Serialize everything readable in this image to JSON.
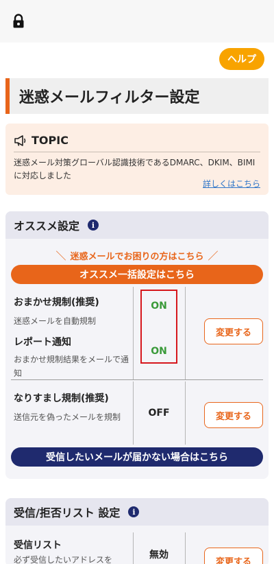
{
  "header": {
    "help_label": "ヘルプ"
  },
  "page": {
    "title": "迷惑メールフィルター設定"
  },
  "topic": {
    "title": "TOPIC",
    "text": "迷惑メール対策グローバル認識技術であるDMARC、DKIM、BIMIに対応しました",
    "link": "詳しくはこちら"
  },
  "recommended": {
    "title": "オススメ設定",
    "info_icon": "i",
    "trouble_caption": "迷惑メールでお困りの方はこちら",
    "slash_left": "＼",
    "slash_right": "／",
    "bulk_button": "オススメ一括設定はこちら",
    "items": [
      {
        "title": "おまかせ規制(推奨)",
        "desc": "迷惑メールを自動規制",
        "value": "ON"
      },
      {
        "title": "レポート通知",
        "desc": "おまかせ規制結果をメールで通知",
        "value": "ON"
      },
      {
        "title": "なりすまし規制(推奨)",
        "desc": "送信元を偽ったメールを規制",
        "value": "OFF"
      }
    ],
    "change_label": "変更する",
    "not_receiving_button": "受信したいメールが届かない場合はこちら"
  },
  "lists": {
    "title": "受信/拒否リスト 設定",
    "info_icon": "i",
    "items": [
      {
        "title": "受信リスト",
        "desc": "必ず受信したいアドレスを",
        "value": "無効"
      }
    ],
    "change_label": "変更する"
  },
  "icons": {
    "status": "lock-icon",
    "topic": "megaphone-icon"
  },
  "colors": {
    "accent": "#e8651a",
    "help": "#f8a300",
    "navy": "#1f2a6e",
    "on": "#3a9a3a",
    "highlight": "#d6161c"
  }
}
